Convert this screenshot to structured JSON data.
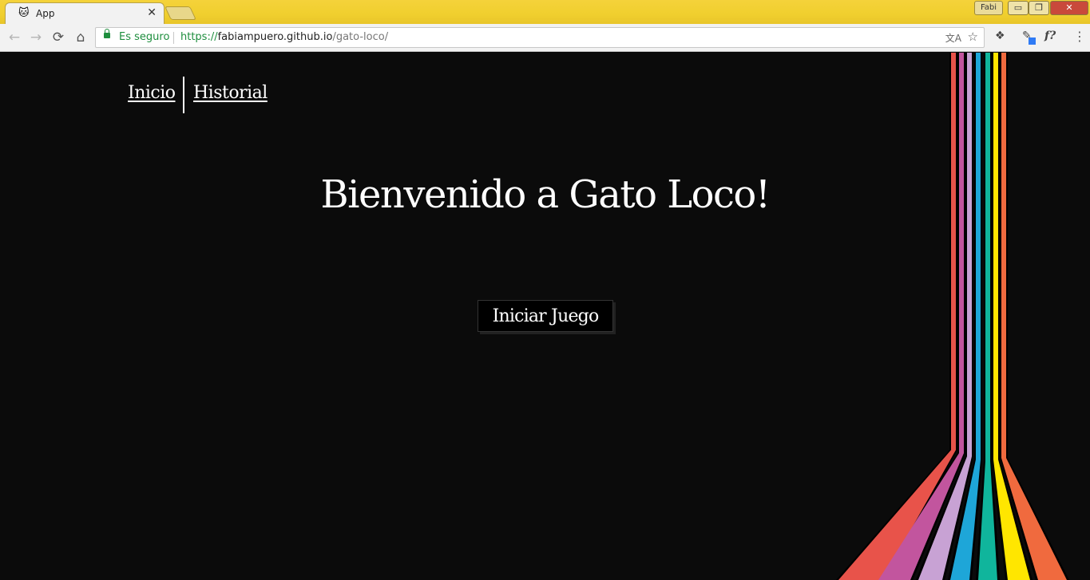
{
  "browser": {
    "tab": {
      "title": "App",
      "favicon": "🐱",
      "close": "✕"
    },
    "profile_label": "Fabi",
    "window_controls": {
      "minimize": "▭",
      "maximize": "❐",
      "close": "✕"
    },
    "nav": {
      "back": "←",
      "forward": "→",
      "reload": "⟳",
      "home": "⌂"
    },
    "security_text": "Es seguro",
    "url": {
      "scheme": "https://",
      "host": "fabiampuero.github.io",
      "path": "/gato-loco/"
    },
    "icons": {
      "translate": "文A",
      "star": "☆",
      "ext1": "❖",
      "ext2": "✎",
      "ext3": "f?",
      "menu": "⋮"
    }
  },
  "page": {
    "nav": {
      "inicio": "Inicio",
      "historial": "Historial"
    },
    "title": "Bienvenido a Gato Loco!",
    "start_button": "Iniciar Juego",
    "colors": {
      "background": "#0b0b0b",
      "stripes": [
        "#e8534a",
        "#c2559e",
        "#c8a2d4",
        "#1ea6d8",
        "#10b59c",
        "#ffe600",
        "#f06a3e"
      ]
    }
  }
}
